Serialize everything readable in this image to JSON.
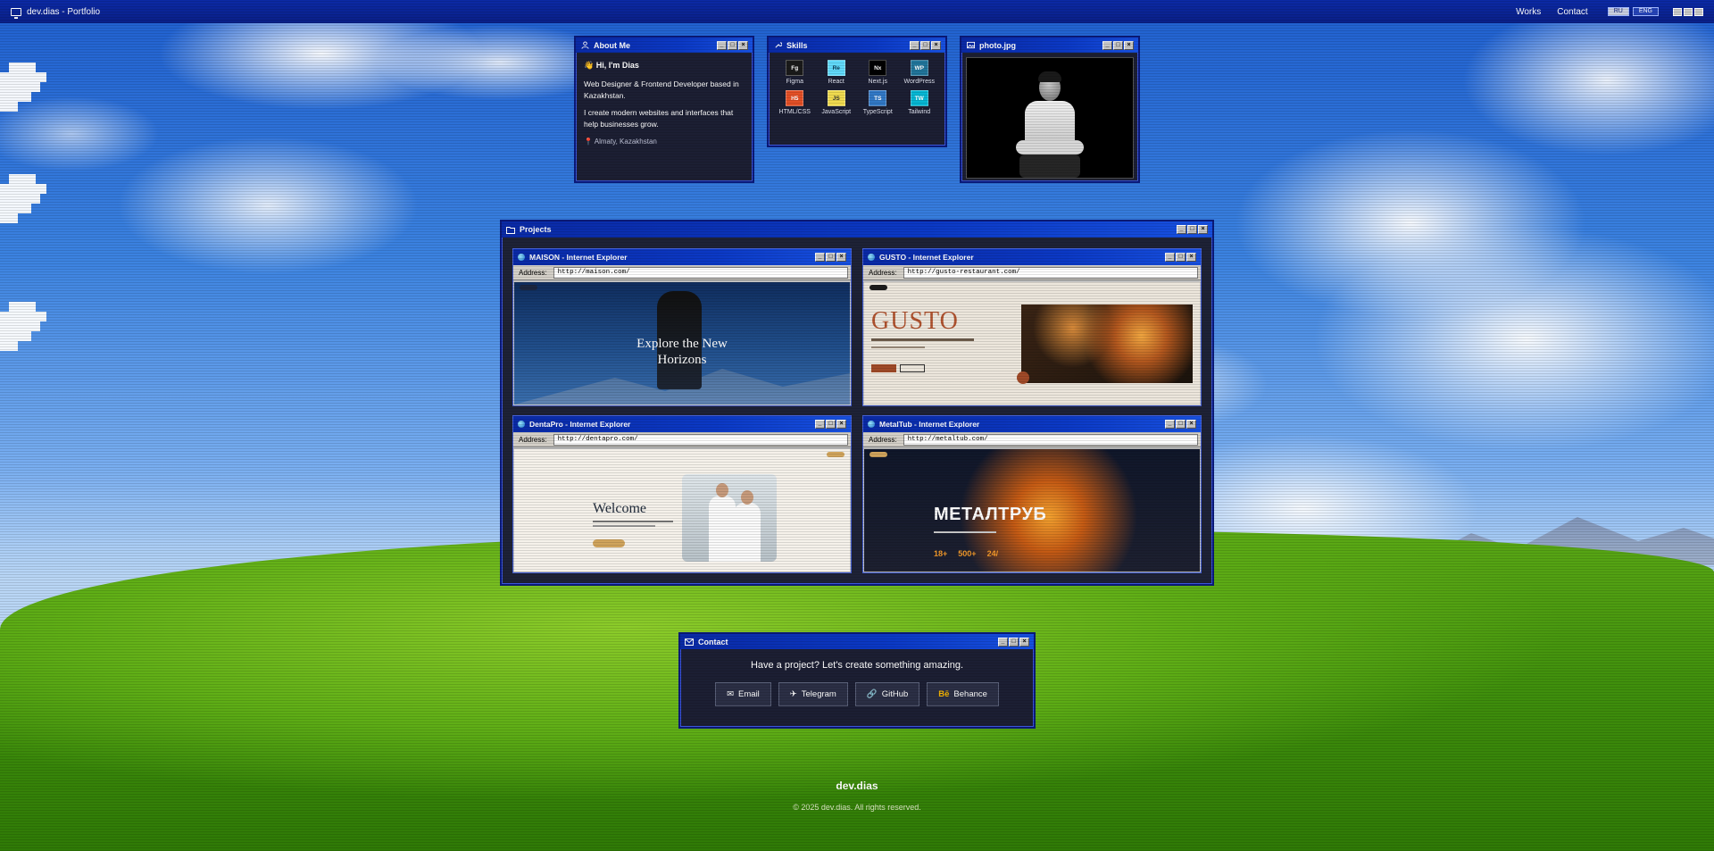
{
  "topbar": {
    "title": "dev.dias - Portfolio",
    "nav": [
      "Works",
      "Contact"
    ],
    "lang": [
      "RU",
      "ENG"
    ]
  },
  "about": {
    "title": "About Me",
    "greeting": "👋 Hi, I'm Dias",
    "line1": "Web Designer & Frontend Developer based in Kazakhstan.",
    "line2": "I create modern websites and interfaces that help businesses grow.",
    "location": "Almaty, Kazakhstan"
  },
  "skills": {
    "title": "Skills",
    "items": [
      {
        "abbr": "Fg",
        "name": "Figma",
        "color": "#1a1a1a",
        "text": "#ffffff"
      },
      {
        "abbr": "Re",
        "name": "React",
        "color": "#61dafb",
        "text": "#0b3b55"
      },
      {
        "abbr": "Nx",
        "name": "Next.js",
        "color": "#000000",
        "text": "#ffffff"
      },
      {
        "abbr": "WP",
        "name": "WordPress",
        "color": "#21759b",
        "text": "#ffffff"
      },
      {
        "abbr": "H5",
        "name": "HTML/CSS",
        "color": "#e34f26",
        "text": "#ffffff"
      },
      {
        "abbr": "JS",
        "name": "JavaScript",
        "color": "#f0db4f",
        "text": "#323330"
      },
      {
        "abbr": "TS",
        "name": "TypeScript",
        "color": "#3178c6",
        "text": "#ffffff"
      },
      {
        "abbr": "TW",
        "name": "Tailwind",
        "color": "#06b6d4",
        "text": "#ffffff"
      }
    ]
  },
  "photo": {
    "title": "photo.jpg"
  },
  "projects": {
    "title": "Projects",
    "address_label": "Address:",
    "items": [
      {
        "title": "MAISON - Internet Explorer",
        "url": "http://maison.com/",
        "hero": "Explore the New Horizons"
      },
      {
        "title": "GUSTO - Internet Explorer",
        "url": "http://gusto-restaurant.com/",
        "hero": "GUSTO"
      },
      {
        "title": "DentaPro - Internet Explorer",
        "url": "http://dentapro.com/",
        "hero": "Welcome"
      },
      {
        "title": "MetalTub - Internet Explorer",
        "url": "http://metaltub.com/",
        "hero": "МЕТАЛТРУБ",
        "stats": [
          "18+",
          "500+",
          "24/"
        ]
      }
    ]
  },
  "contact": {
    "title": "Contact",
    "lead": "Have a project? Let's create something amazing.",
    "buttons": [
      {
        "icon": "✉",
        "label": "Email"
      },
      {
        "icon": "✈",
        "label": "Telegram"
      },
      {
        "icon": "🔗",
        "label": "GitHub"
      },
      {
        "icon": "Bē",
        "label": "Behance"
      }
    ]
  },
  "footer": {
    "brand": "dev.dias",
    "copyright": "© 2025 dev.dias. All rights reserved."
  }
}
